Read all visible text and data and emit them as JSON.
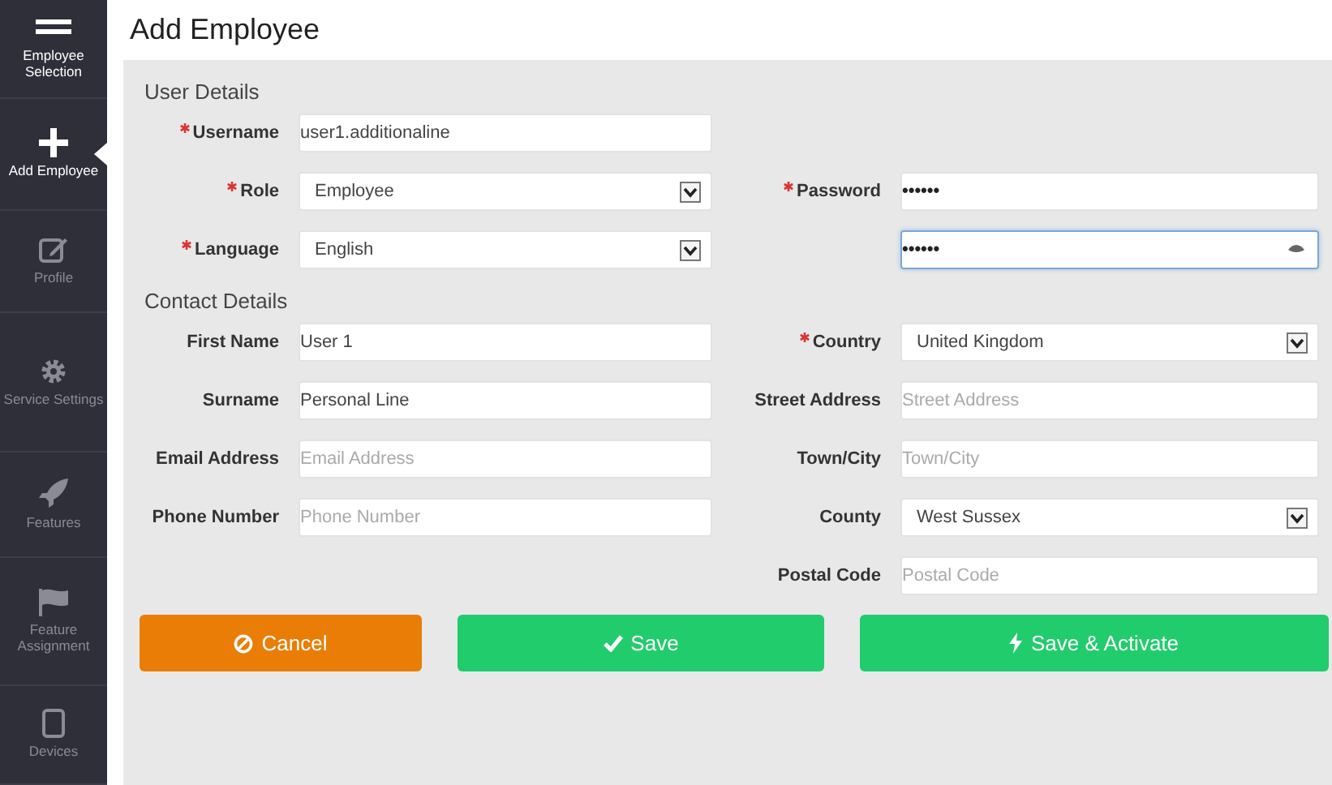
{
  "sidebar": {
    "items": [
      {
        "label": "Employee Selection",
        "selected": false
      },
      {
        "label": "Add Employee",
        "selected": true
      },
      {
        "label": "Profile",
        "selected": false
      },
      {
        "label": "Service Settings",
        "selected": false
      },
      {
        "label": "Features",
        "selected": false
      },
      {
        "label": "Feature Assignment",
        "selected": false
      },
      {
        "label": "Devices",
        "selected": false
      }
    ]
  },
  "page_title": "Add Employee",
  "sections": [
    {
      "title": "User Details",
      "rows": [
        {
          "left": {
            "label": "Username",
            "required": true,
            "kind": "text",
            "value": "user1.additionaline",
            "focused": false
          }
        },
        {
          "left": {
            "label": "Role",
            "required": true,
            "kind": "select",
            "value": "Employee",
            "focused": false
          },
          "right": {
            "label": "Password",
            "required": true,
            "kind": "password",
            "value": "••••••",
            "focused": false
          }
        },
        {
          "left": {
            "label": "Language",
            "required": true,
            "kind": "select",
            "value": "English",
            "focused": false
          },
          "right": {
            "kind": "password-reveal",
            "value": "••••••",
            "focused": true
          }
        }
      ]
    },
    {
      "title": "Contact Details",
      "rows": [
        {
          "left": {
            "label": "First Name",
            "required": false,
            "kind": "text",
            "value": "User 1",
            "focused": false
          },
          "right": {
            "label": "Country",
            "required": true,
            "kind": "select",
            "value": "United Kingdom",
            "focused": false
          }
        },
        {
          "left": {
            "label": "Surname",
            "required": false,
            "kind": "text",
            "value": "Personal Line",
            "focused": false
          },
          "right": {
            "label": "Street Address",
            "required": false,
            "kind": "text",
            "placeholder": "Street Address",
            "focused": false
          }
        },
        {
          "left": {
            "label": "Email Address",
            "required": false,
            "kind": "text",
            "placeholder": "Email Address",
            "focused": false
          },
          "right": {
            "label": "Town/City",
            "required": false,
            "kind": "text",
            "placeholder": "Town/City",
            "focused": false
          }
        },
        {
          "left": {
            "label": "Phone Number",
            "required": false,
            "kind": "text",
            "placeholder": "Phone Number",
            "focused": false
          },
          "right": {
            "label": "County",
            "required": false,
            "kind": "select",
            "value": "West Sussex",
            "focused": false
          }
        },
        {
          "right": {
            "label": "Postal Code",
            "required": false,
            "kind": "text",
            "placeholder": "Postal Code",
            "focused": false
          }
        }
      ]
    }
  ],
  "buttons": [
    {
      "label": "Cancel",
      "kind": "cancel"
    },
    {
      "label": "Save",
      "kind": "save"
    },
    {
      "label": "Save & Activate",
      "kind": "activate"
    }
  ]
}
